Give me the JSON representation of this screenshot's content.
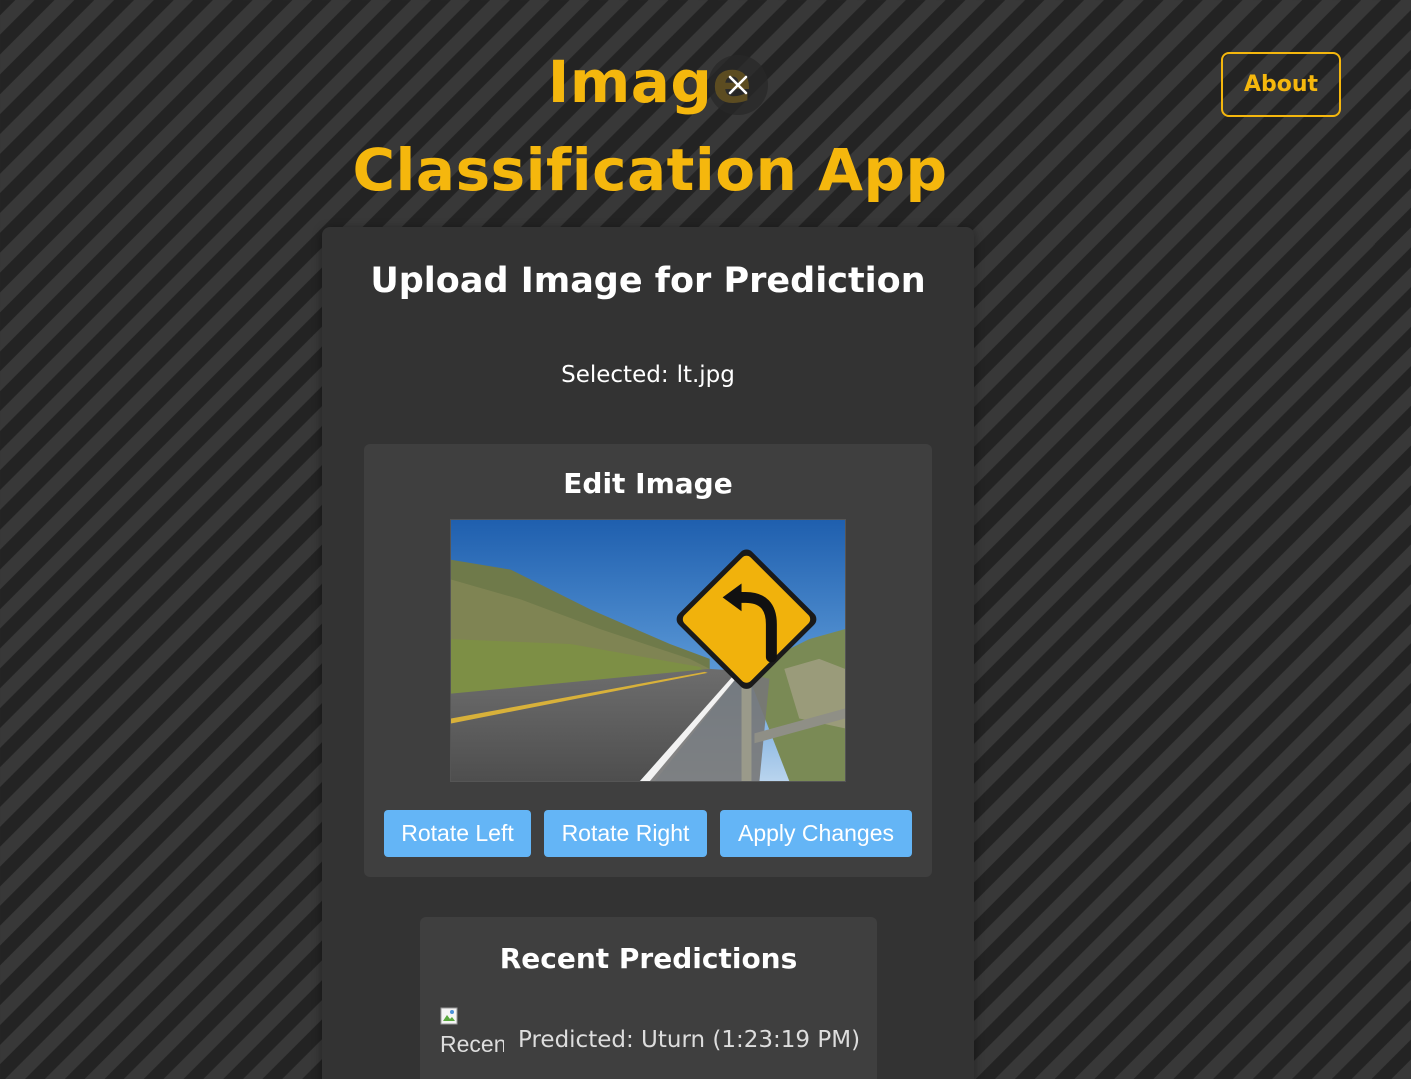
{
  "header": {
    "title_line1": "Image",
    "title_line2": "Classification App",
    "about_label": "About",
    "close_icon": "close-icon"
  },
  "upload": {
    "heading": "Upload Image for Prediction",
    "selected_label": "Selected:",
    "selected_file": "lt.jpg"
  },
  "editor": {
    "heading": "Edit Image",
    "image_subject": "yellow road sign with left curve arrow beside a highway",
    "buttons": {
      "rotate_left": "Rotate Left",
      "rotate_right": "Rotate Right",
      "apply": "Apply Changes"
    }
  },
  "recent": {
    "heading": "Recent Predictions",
    "items": [
      {
        "thumb_alt": "Recent",
        "prefix": "Predicted:",
        "label": "Uturn",
        "time": "(1:23:19 PM)"
      }
    ]
  },
  "colors": {
    "accent": "#f5b70d",
    "button": "#64b5f6",
    "card": "#333333",
    "panel": "#3f3f3f"
  }
}
